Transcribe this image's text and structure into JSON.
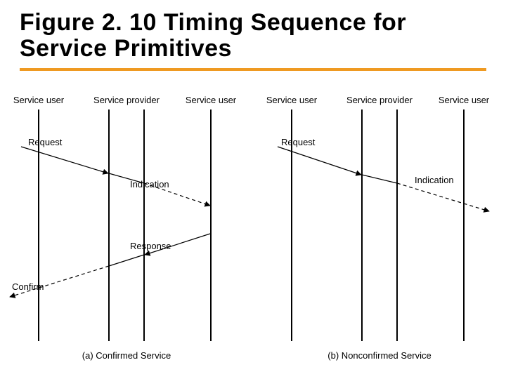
{
  "title": "Figure 2. 10 Timing Sequence for Service Primitives",
  "roles": {
    "user_left": "Service user",
    "provider": "Service provider",
    "user_right": "Service user"
  },
  "messages": {
    "request": "Request",
    "indication": "Indication",
    "response": "Response",
    "confirm": "Confirm"
  },
  "captions": {
    "confirmed": "(a) Confirmed Service",
    "nonconfirmed": "(b) Nonconfirmed Service"
  }
}
